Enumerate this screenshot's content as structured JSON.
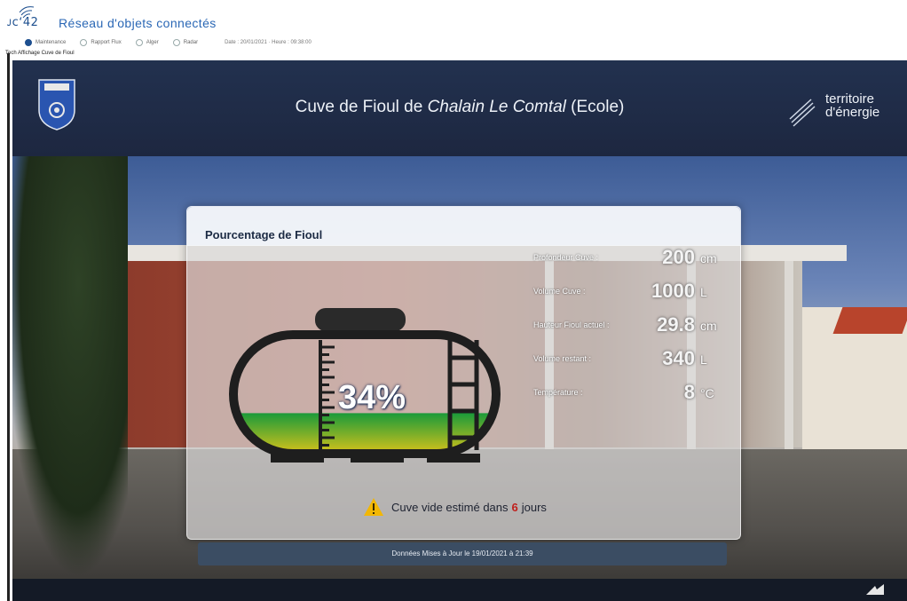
{
  "app": {
    "logo_text": "ᴊcʻ42",
    "title": "Réseau d'objets connectés",
    "subtitle": "Tech Affichage Cuve de Fioul",
    "radios": [
      {
        "label": "Maintenance",
        "selected": true
      },
      {
        "label": "Rapport Flux",
        "selected": false
      },
      {
        "label": "Alger",
        "selected": false
      },
      {
        "label": "Radar",
        "selected": false
      }
    ],
    "datetime": "Date : 20/01/2021 · Heure : 09:38:00"
  },
  "banner": {
    "title_prefix": "Cuve de Fioul de",
    "title_place": "Chalain Le Comtal",
    "title_suffix": "(Ecole)",
    "brand_line1": "territoire",
    "brand_line2": "d'énergie"
  },
  "panel": {
    "title": "Pourcentage de Fioul",
    "percentage_text": "34%",
    "fill_level": 0.34,
    "rows": [
      {
        "label": "Profondeur Cuve :",
        "value": "200",
        "unit": "cm"
      },
      {
        "label": "Volume Cuve :",
        "value": "1000",
        "unit": "L"
      },
      {
        "label": "Hauteur Fioul actuel :",
        "value": "29.8",
        "unit": "cm"
      },
      {
        "label": "Volume restant :",
        "value": "340",
        "unit": "L"
      },
      {
        "label": "Température :",
        "value": "8",
        "unit": "°C"
      }
    ],
    "warning_prefix": "Cuve vide estimé dans",
    "warning_days": "6",
    "warning_suffix": "jours",
    "update_text": "Données Mises à Jour le 19/01/2021 à 21:39"
  },
  "colors": {
    "accent": "#2a67b5",
    "warning_days": "#c0201c",
    "fuel_top": "#1a9a3a",
    "fuel_bottom": "#d8c21a"
  }
}
